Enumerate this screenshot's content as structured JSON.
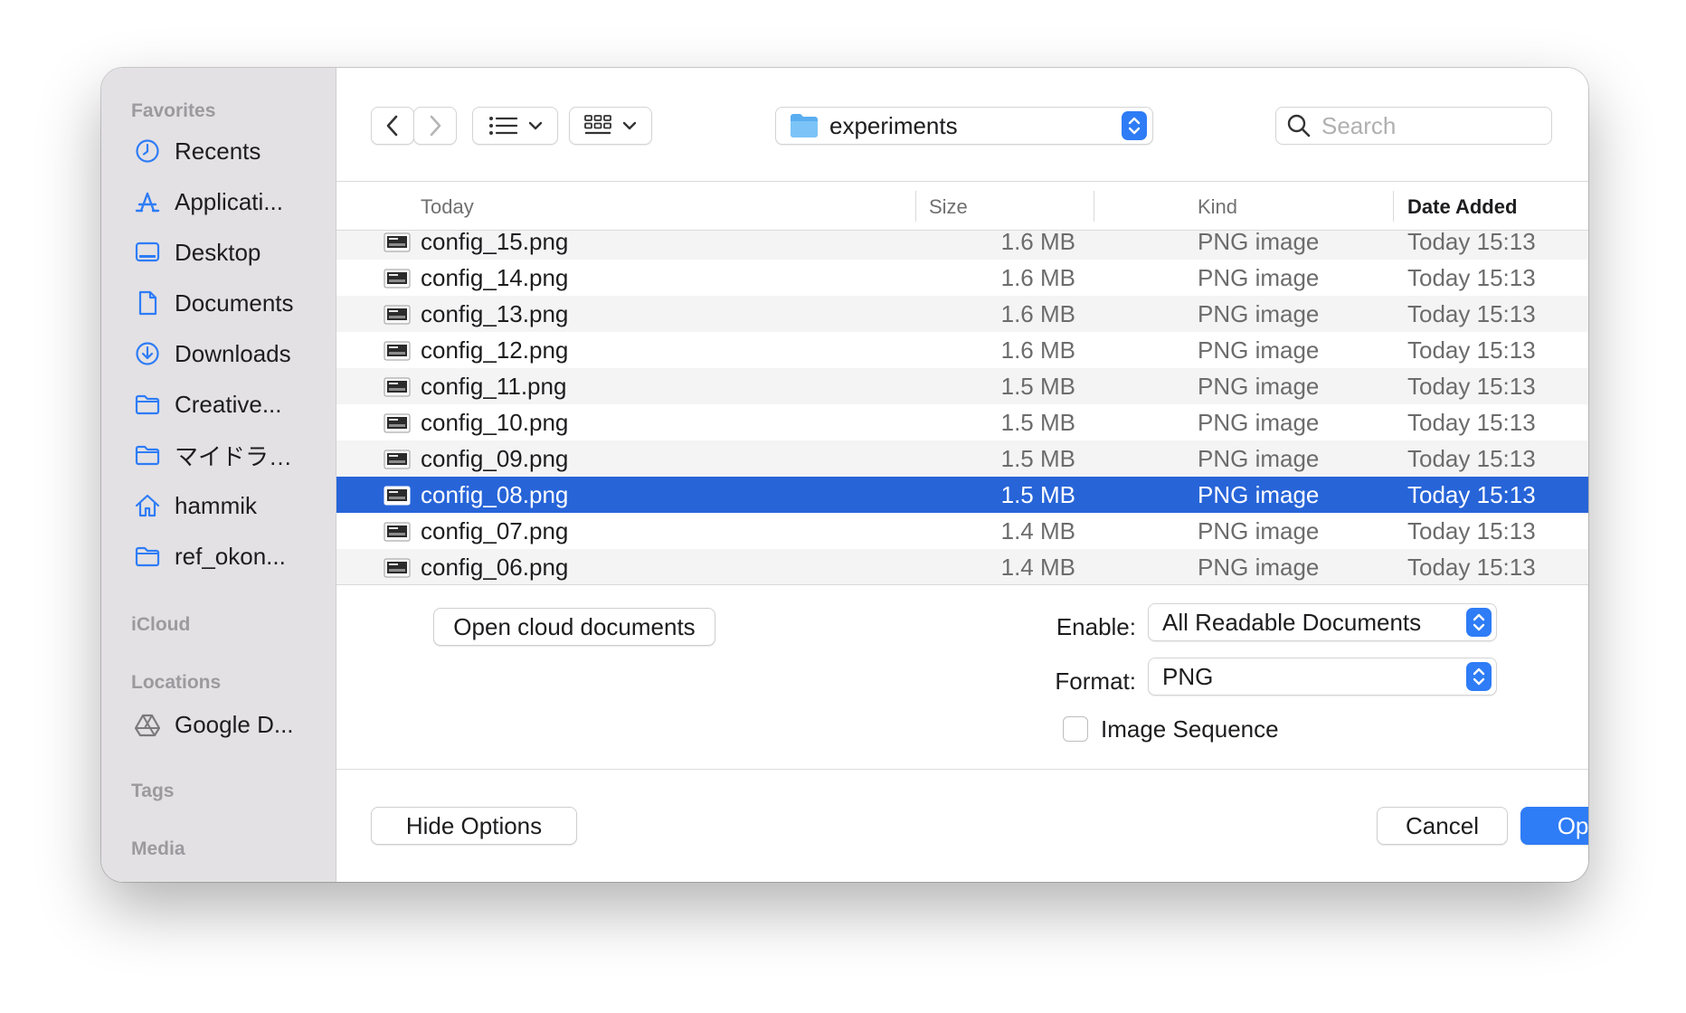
{
  "sidebar": {
    "sections": {
      "favorites": "Favorites",
      "icloud": "iCloud",
      "locations": "Locations",
      "tags": "Tags",
      "media": "Media"
    },
    "favorites": [
      {
        "label": "Recents",
        "icon": "clock-icon"
      },
      {
        "label": "Applicati...",
        "icon": "applications-icon"
      },
      {
        "label": "Desktop",
        "icon": "desktop-icon"
      },
      {
        "label": "Documents",
        "icon": "document-icon"
      },
      {
        "label": "Downloads",
        "icon": "download-icon"
      },
      {
        "label": "Creative...",
        "icon": "folder-icon"
      },
      {
        "label": "マイドラ…",
        "icon": "folder-icon"
      },
      {
        "label": "hammik",
        "icon": "home-icon"
      },
      {
        "label": "ref_okon...",
        "icon": "folder-icon"
      }
    ],
    "locations": [
      {
        "label": "Google D...",
        "icon": "google-drive-icon"
      }
    ]
  },
  "toolbar": {
    "current_folder": "experiments",
    "search_placeholder": "Search"
  },
  "columns": {
    "name": "Today",
    "size": "Size",
    "kind": "Kind",
    "date": "Date Added"
  },
  "files": [
    {
      "name": "config_15.png",
      "size": "1.6 MB",
      "kind": "PNG image",
      "date": "Today 15:13"
    },
    {
      "name": "config_14.png",
      "size": "1.6 MB",
      "kind": "PNG image",
      "date": "Today 15:13"
    },
    {
      "name": "config_13.png",
      "size": "1.6 MB",
      "kind": "PNG image",
      "date": "Today 15:13"
    },
    {
      "name": "config_12.png",
      "size": "1.6 MB",
      "kind": "PNG image",
      "date": "Today 15:13"
    },
    {
      "name": "config_11.png",
      "size": "1.5 MB",
      "kind": "PNG image",
      "date": "Today 15:13"
    },
    {
      "name": "config_10.png",
      "size": "1.5 MB",
      "kind": "PNG image",
      "date": "Today 15:13"
    },
    {
      "name": "config_09.png",
      "size": "1.5 MB",
      "kind": "PNG image",
      "date": "Today 15:13"
    },
    {
      "name": "config_08.png",
      "size": "1.5 MB",
      "kind": "PNG image",
      "date": "Today 15:13",
      "selected": true
    },
    {
      "name": "config_07.png",
      "size": "1.4 MB",
      "kind": "PNG image",
      "date": "Today 15:13"
    },
    {
      "name": "config_06.png",
      "size": "1.4 MB",
      "kind": "PNG image",
      "date": "Today 15:13"
    }
  ],
  "options": {
    "open_cloud_label": "Open cloud documents",
    "enable_label": "Enable:",
    "enable_value": "All Readable Documents",
    "format_label": "Format:",
    "format_value": "PNG",
    "image_sequence_label": "Image Sequence",
    "image_sequence_checked": false
  },
  "footer": {
    "hide_options_label": "Hide Options",
    "cancel_label": "Cancel",
    "open_label": "Open"
  },
  "colors": {
    "accent": "#2e7cf6",
    "selection": "#2764d8",
    "sidebar_bg": "#e3e1e4"
  }
}
